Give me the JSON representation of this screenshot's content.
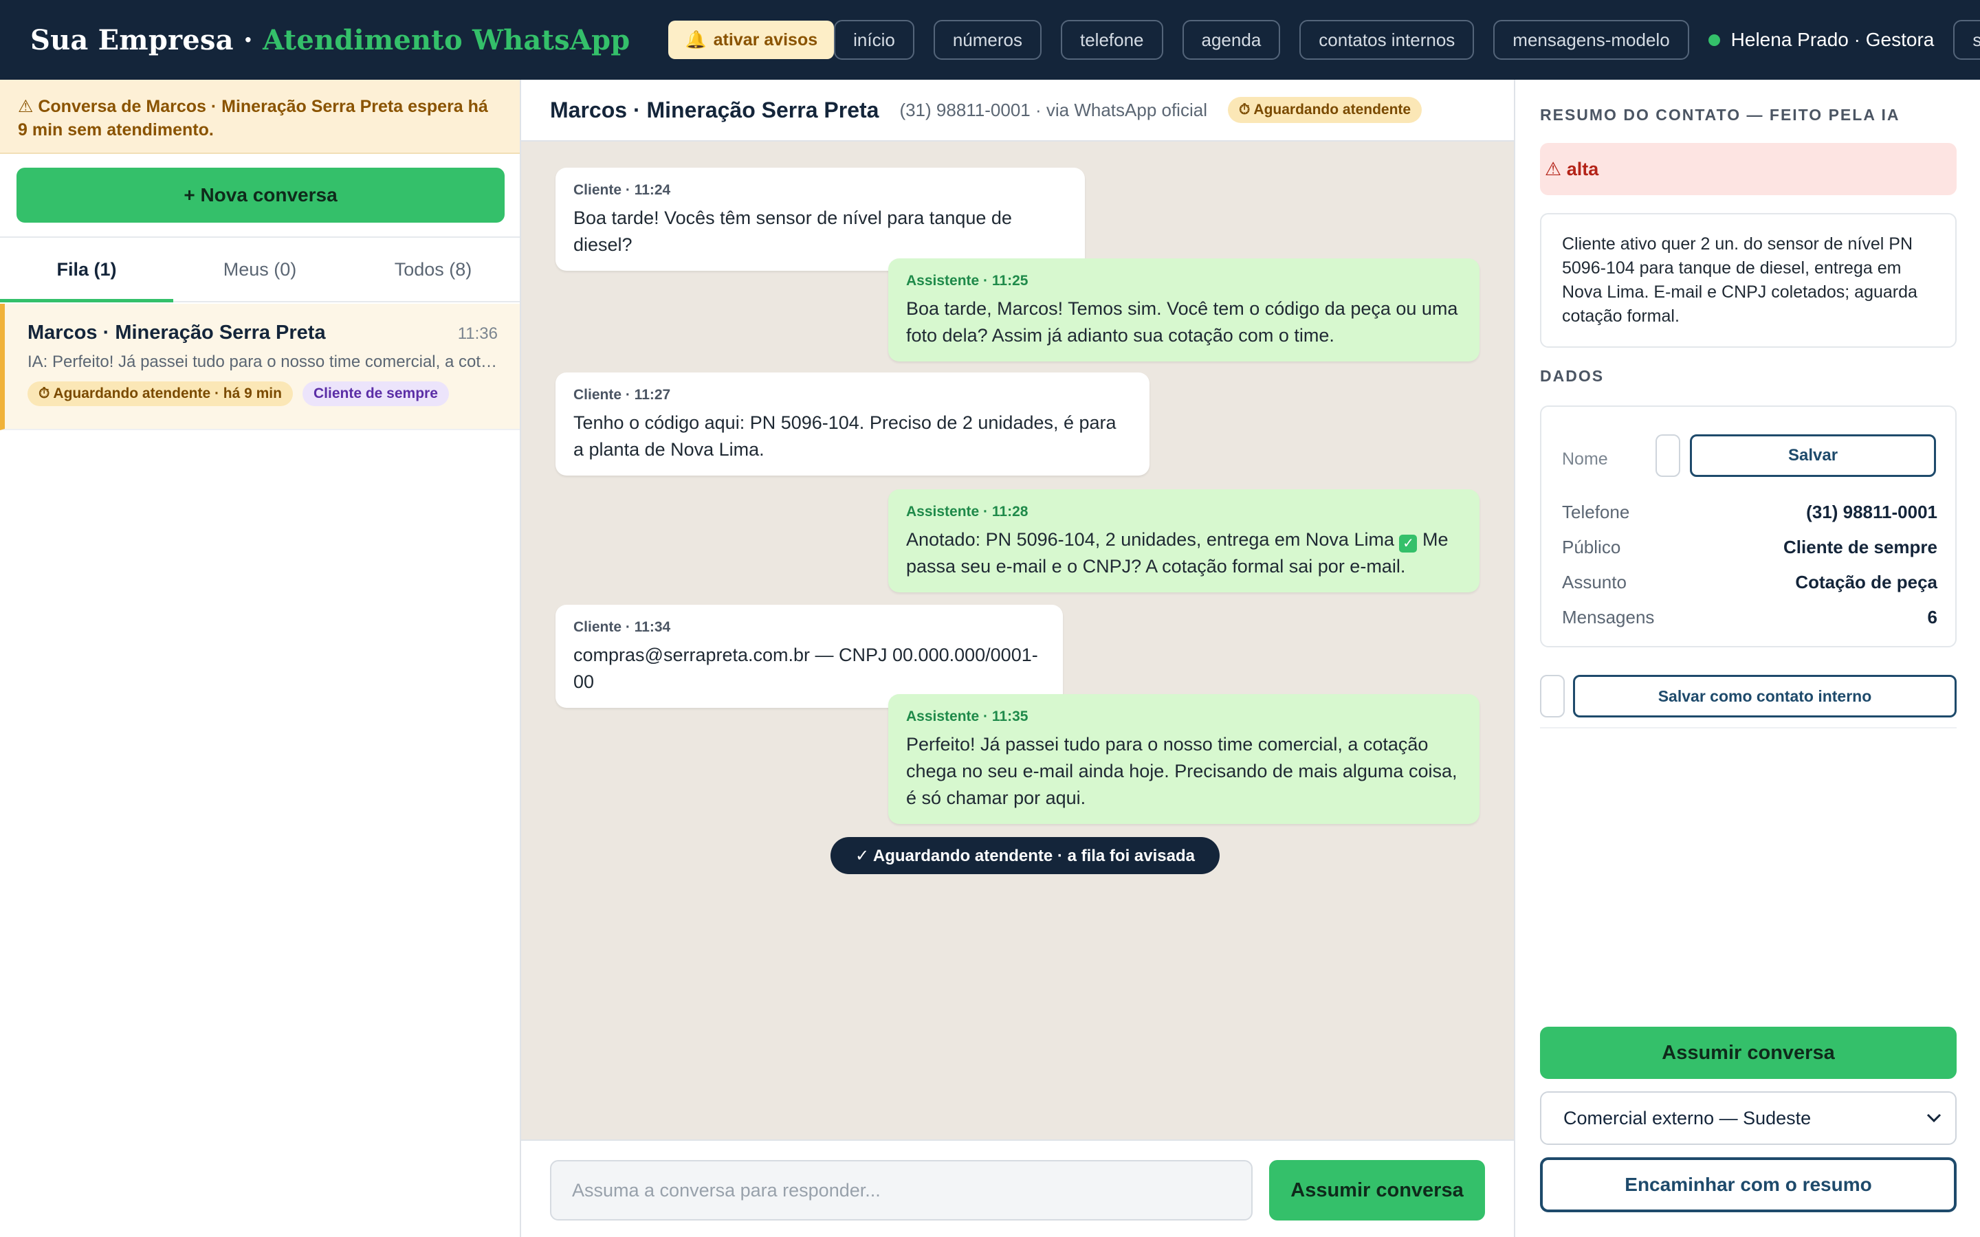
{
  "topbar": {
    "brand_prefix": "Sua Empresa · ",
    "brand_accent": "Atendimento WhatsApp",
    "alert_icon": "bell-icon",
    "alert_label": "ativar avisos",
    "nav": [
      "início",
      "números",
      "telefone",
      "agenda",
      "contatos internos",
      "mensagens-modelo"
    ],
    "user_name": "Helena Prado · Gestora",
    "logout_label": "sair"
  },
  "sidebar": {
    "banner": "⚠ Conversa de Marcos · Mineração Serra Preta espera há 9 min sem atendimento.",
    "new_conversation": "+ Nova conversa",
    "tabs": [
      "Fila (1)",
      "Meus (0)",
      "Todos (8)"
    ],
    "active_tab": "Fila (1)",
    "conversation": {
      "name": "Marcos · Mineração Serra Preta",
      "time": "11:36",
      "preview": "IA: Perfeito! Já passei tudo para o nosso time comercial, a cotação chega no seu e-mail ainda hoje.",
      "status_badge": "⏱ Aguardando atendente · há 9 min",
      "audience_badge": "Cliente de sempre"
    }
  },
  "chat": {
    "title": "Marcos · Mineração Serra Preta",
    "subtitle": "(31) 98811-0001 · via WhatsApp oficial",
    "status": "⏱ Aguardando atendente",
    "messages": [
      {
        "from": "client",
        "meta": "Cliente · 11:24",
        "text": "Boa tarde! Vocês têm sensor de nível para tanque de diesel?"
      },
      {
        "from": "bot",
        "meta": "Assistente · 11:25",
        "text": "Boa tarde, Marcos! Temos sim. Você tem o código da peça ou uma foto dela? Assim já adianto sua cotação com o time."
      },
      {
        "from": "client",
        "meta": "Cliente · 11:27",
        "text": "Tenho o código aqui: PN 5096-104. Preciso de 2 unidades, é para a planta de Nova Lima."
      },
      {
        "from": "bot",
        "meta": "Assistente · 11:28",
        "text_before": "Anotado: PN 5096-104, 2 unidades, entrega em Nova Lima ",
        "text_icon": "✓",
        "text_after": " Me passa seu e-mail e o CNPJ? A cotação formal sai por e-mail."
      },
      {
        "from": "client",
        "meta": "Cliente · 11:34",
        "text": "compras@serrapreta.com.br — CNPJ 00.000.000/0001-00"
      },
      {
        "from": "bot",
        "meta": "Assistente · 11:35",
        "text": "Perfeito! Já passei tudo para o nosso time comercial, a cotação chega no seu e-mail ainda hoje. Precisando de mais alguma coisa, é só chamar por aqui."
      }
    ],
    "system_pill": "✓ Aguardando atendente · a fila foi avisada",
    "composer_placeholder": "Assuma a conversa para responder...",
    "composer_button": "Assumir conversa"
  },
  "panel": {
    "summary_title": "RESUMO DO CONTATO — FEITO PELA IA",
    "priority": "⚠ alta",
    "summary": "Cliente ativo quer 2 un. do sensor de nível PN 5096-104 para tanque de diesel, entrega em Nova Lima. E-mail e CNPJ coletados; aguarda cotação formal.",
    "data_title": "DADOS",
    "name_label": "Nome",
    "save_label": "Salvar",
    "fields": [
      {
        "key": "Telefone",
        "value": "(31) 98811-0001"
      },
      {
        "key": "Público",
        "value": "Cliente de sempre"
      },
      {
        "key": "Assunto",
        "value": "Cotação de peça"
      },
      {
        "key": "Mensagens",
        "value": "6"
      }
    ],
    "internal_label": "Salvar como contato interno",
    "assume_label": "Assumir conversa",
    "team_selected": "Comercial externo — Sudeste",
    "forward_label": "Encaminhar com o resumo"
  },
  "colors": {
    "topbar": "#14253a",
    "accent_green": "#34c06a",
    "warning_bg": "#fdf0d6",
    "bot_bubble": "#d7f8cf",
    "chat_bg": "#ece7e0",
    "priority_bg": "#fde4e2"
  }
}
